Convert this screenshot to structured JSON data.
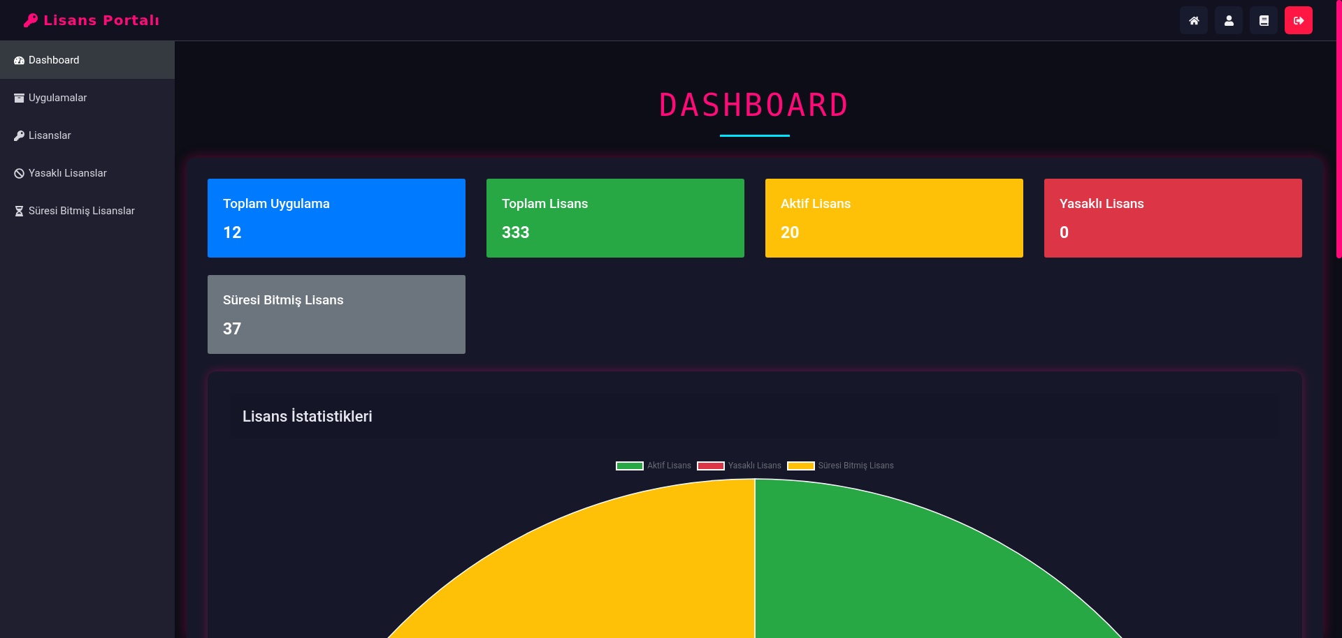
{
  "brand": {
    "title": "Lisans Portalı"
  },
  "toolbar": [
    {
      "kind": "home"
    },
    {
      "kind": "user"
    },
    {
      "kind": "book"
    },
    {
      "kind": "logout"
    }
  ],
  "sidebar": {
    "items": [
      {
        "label": "Dashboard",
        "kind": "gauge",
        "selected": true
      },
      {
        "label": "Uygulamalar",
        "kind": "box",
        "selected": false
      },
      {
        "label": "Lisanslar",
        "kind": "key",
        "selected": false
      },
      {
        "label": "Yasaklı Lisanslar",
        "kind": "ban",
        "selected": false
      },
      {
        "label": "Süresi Bitmiş Lisanslar",
        "kind": "hourglass",
        "selected": false
      }
    ]
  },
  "page_title": "DASHBOARD",
  "stats": [
    {
      "label": "Toplam Uygulama",
      "value": "12",
      "color": "#007bff"
    },
    {
      "label": "Toplam Lisans",
      "value": "333",
      "color": "#28a745"
    },
    {
      "label": "Aktif Lisans",
      "value": "20",
      "color": "#ffc107"
    },
    {
      "label": "Yasaklı Lisans",
      "value": "0",
      "color": "#dc3545"
    },
    {
      "label": "Süresi Bitmiş Lisans",
      "value": "37",
      "color": "#6c757d"
    }
  ],
  "chart_card": {
    "title": "Lisans İstatistikleri",
    "chart_data": {
      "type": "pie",
      "legend": "top",
      "categories": [
        "Aktif Lisans",
        "Yasaklı Lisans",
        "Süresi Bitmiş Lisans"
      ],
      "series": [
        {
          "colors": [
            "#28a745",
            "#dc3545",
            "#ffc107"
          ],
          "values": [
            35.09,
            0,
            64.91
          ]
        }
      ]
    }
  }
}
